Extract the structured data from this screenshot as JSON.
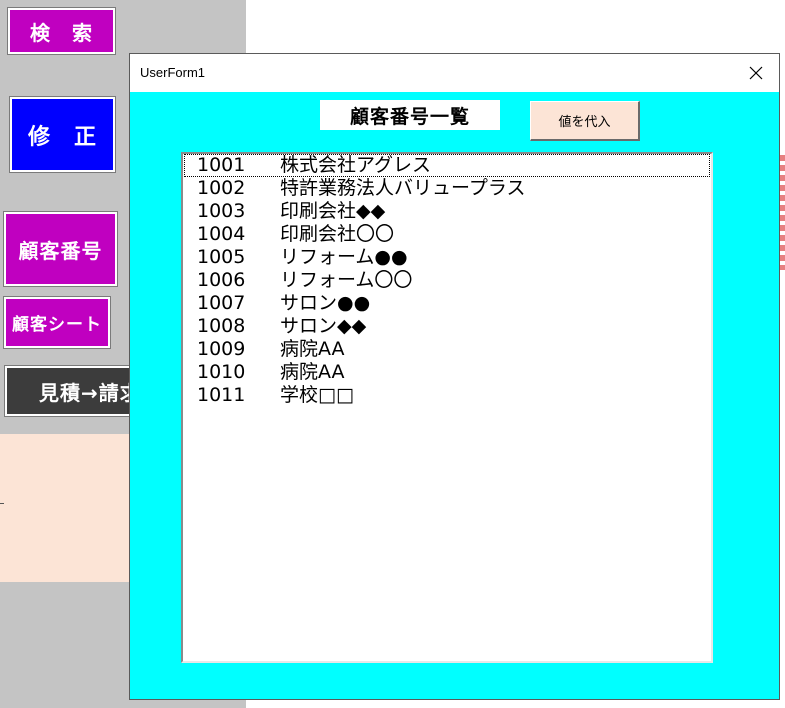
{
  "sheet": {
    "buttons": {
      "search": "検　索",
      "edit": "修　正",
      "customer_number": "顧客番号",
      "customer_sheet": "顧客シート",
      "estimate_to_invoice": "見積→請求"
    }
  },
  "userform": {
    "title": "UserForm1",
    "heading": "顧客番号一覧",
    "assign_button": "値を代入",
    "close_icon": "close-icon",
    "background_color": "#00ffff",
    "selected_index": 0,
    "list": [
      {
        "id": "1001",
        "name": "株式会社アグレス"
      },
      {
        "id": "1002",
        "name": "特許業務法人バリュープラス"
      },
      {
        "id": "1003",
        "name": "印刷会社◆◆"
      },
      {
        "id": "1004",
        "name": "印刷会社〇〇"
      },
      {
        "id": "1005",
        "name": "リフォーム●●"
      },
      {
        "id": "1006",
        "name": "リフォーム〇〇"
      },
      {
        "id": "1007",
        "name": "サロン●●"
      },
      {
        "id": "1008",
        "name": "サロン◆◆"
      },
      {
        "id": "1009",
        "name": "病院AA"
      },
      {
        "id": "1010",
        "name": "病院AA"
      },
      {
        "id": "1011",
        "name": "学校□□"
      }
    ]
  }
}
